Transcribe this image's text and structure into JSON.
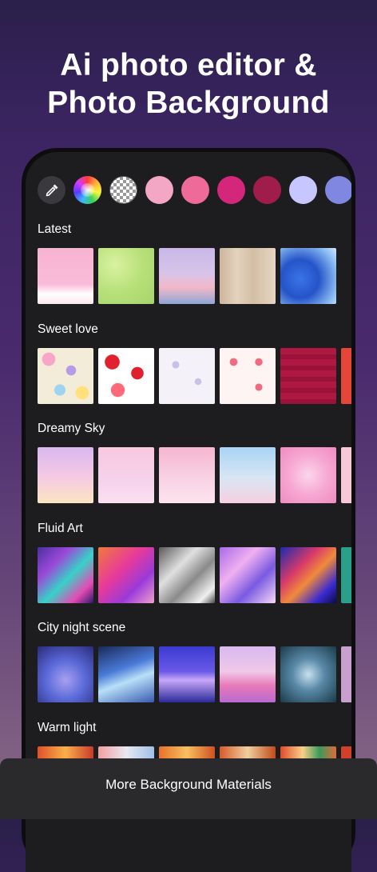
{
  "header": {
    "line1": "Ai photo editor &",
    "line2": "Photo Background"
  },
  "color_palette": {
    "picker": "eyedropper-icon",
    "swatches": [
      "#f4a7c5",
      "#ee6a98",
      "#d4267b",
      "#a01d4b",
      "#c8c6ff",
      "#7f87e0"
    ]
  },
  "sections": [
    {
      "title": "Latest",
      "thumbs": [
        "linear-gradient(180deg,#f7b3d2 0%,#f9bcd8 65%,#ffffff 82%,#ffe6f0 100%)",
        "radial-gradient(circle at 30% 30%,#d9f2a0 0%,#b8e07a 50%,#a6d46a 100%)",
        "linear-gradient(180deg,#c9b8e8 0%,#d7c4ea 45%,#f2b8c8 70%,#8ea6d4 100%)",
        "linear-gradient(90deg,#cdb59c 0%,#e3d2bd 30%,#d4bfa4 60%,#e6d6c3 100%)",
        "radial-gradient(circle at 35% 55%,#3a74e8 0%,#2554c8 40%,#8fc0f4 80%,#d4e6fa 100%)"
      ]
    },
    {
      "title": "Sweet love",
      "thumbs": [
        "radial-gradient(circle at 20% 20%,#f7a6c7 10%,transparent 11%),radial-gradient(circle at 60% 40%,#b79ae8 10%,transparent 11%),radial-gradient(circle at 40% 75%,#9fd4f0 10%,transparent 11%),radial-gradient(circle at 80% 80%,#ffe07a 10%,transparent 11%),#f2ecd8",
        "radial-gradient(circle at 25% 25%,#e01f2f 12%,transparent 13%),radial-gradient(circle at 70% 45%,#e01f2f 12%,transparent 13%),radial-gradient(circle at 35% 75%,#ff6a7a 12%,transparent 13%),#ffffff",
        "radial-gradient(circle at 30% 30%,#c7c2e8 6%,transparent 7%),radial-gradient(circle at 70% 60%,#c7c2e8 6%,transparent 7%),#f4f2f8",
        "radial-gradient(circle at 25% 25%,#f26a80 6%,transparent 7%),radial-gradient(circle at 70% 70%,#f26a80 6%,transparent 7%),radial-gradient(circle at 70% 25%,#f26a80 6%,transparent 7%),#fff4f4",
        "repeating-linear-gradient(180deg,#b01844 0 8px,#9a1238 8px 14px)",
        "#e6453a"
      ]
    },
    {
      "title": "Dreamy Sky",
      "thumbs": [
        "linear-gradient(180deg,#d8b8f0 0%,#f4c8e4 50%,#fce4c0 100%)",
        "linear-gradient(180deg,#f8c8e0 0%,#f6d2ec 60%,#fbe0f0 100%)",
        "linear-gradient(180deg,#f6b6d0 0%,#f8cfe2 50%,#fde4ee 100%)",
        "linear-gradient(180deg,#a8d4f4 0%,#d8e6f4 55%,#f6d0e0 100%)",
        "radial-gradient(circle at 50% 50%,#fbd6ec 0%,#f7a8d2 50%,#f08ac0 100%)",
        "#f6c8d8"
      ]
    },
    {
      "title": "Fluid Art",
      "thumbs": [
        "linear-gradient(135deg,#4a2fa0 0%,#9a4ad8 30%,#37d2c8 55%,#e44ab4 80%,#2a1a6a 100%)",
        "linear-gradient(135deg,#f07a3a 0%,#e83a9a 40%,#9a3ad8 70%,#f0a0d0 100%)",
        "linear-gradient(135deg,#5a5a5a 0%,#e0e0e0 35%,#8a8a8a 60%,#f0f0f0 85%,#4a4a4a 100%)",
        "linear-gradient(135deg,#a86ae8 0%,#f0b0f0 35%,#7a5ae0 65%,#f8d8f8 100%)",
        "linear-gradient(135deg,#1a2ab0 0%,#d83a6a 35%,#f08a3a 55%,#3a2ad0 80%,#0a0a4a 100%)",
        "#2aa08a"
      ]
    },
    {
      "title": "City night scene",
      "thumbs": [
        "radial-gradient(circle at 50% 60%,#a8a0f0 0%,#5a6ad8 45%,#2a2a7a 100%)",
        "linear-gradient(160deg,#1a2a5a 0%,#4a7ad8 40%,#b8e0f8 60%,#3a5ab0 100%)",
        "linear-gradient(180deg,#3a3ad0 0%,#6a5ae8 45%,#c8a8f8 60%,#2a2a9a 100%)",
        "linear-gradient(180deg,#d8b8f0 0%,#f0c8e8 45%,#e87ab8 70%,#b86ad0 100%)",
        "radial-gradient(circle at 50% 50%,#c8e0f0 0%,#5a8aa8 40%,#1a3a4a 100%)",
        "#c8a0d0"
      ]
    },
    {
      "title": "Warm light",
      "thumbs": [
        "linear-gradient(90deg,#e0502a 0%,#f8b04a 50%,#c83a2a 100%)",
        "linear-gradient(90deg,#f0a0a0 0%,#e8e8f0 50%,#a0c0e8 100%)",
        "linear-gradient(90deg,#e8702a 0%,#f8c060 50%,#d05020 100%)",
        "linear-gradient(90deg,#d85a2a 0%,#f0d0a0 50%,#c04a1a 100%)",
        "linear-gradient(90deg,#e04a2a 0%,#f8d08a 40%,#3a9a5a 70%,#e06a3a 100%)",
        "#d0402a"
      ]
    }
  ],
  "bottom_button": {
    "label": "More Background Materials"
  }
}
